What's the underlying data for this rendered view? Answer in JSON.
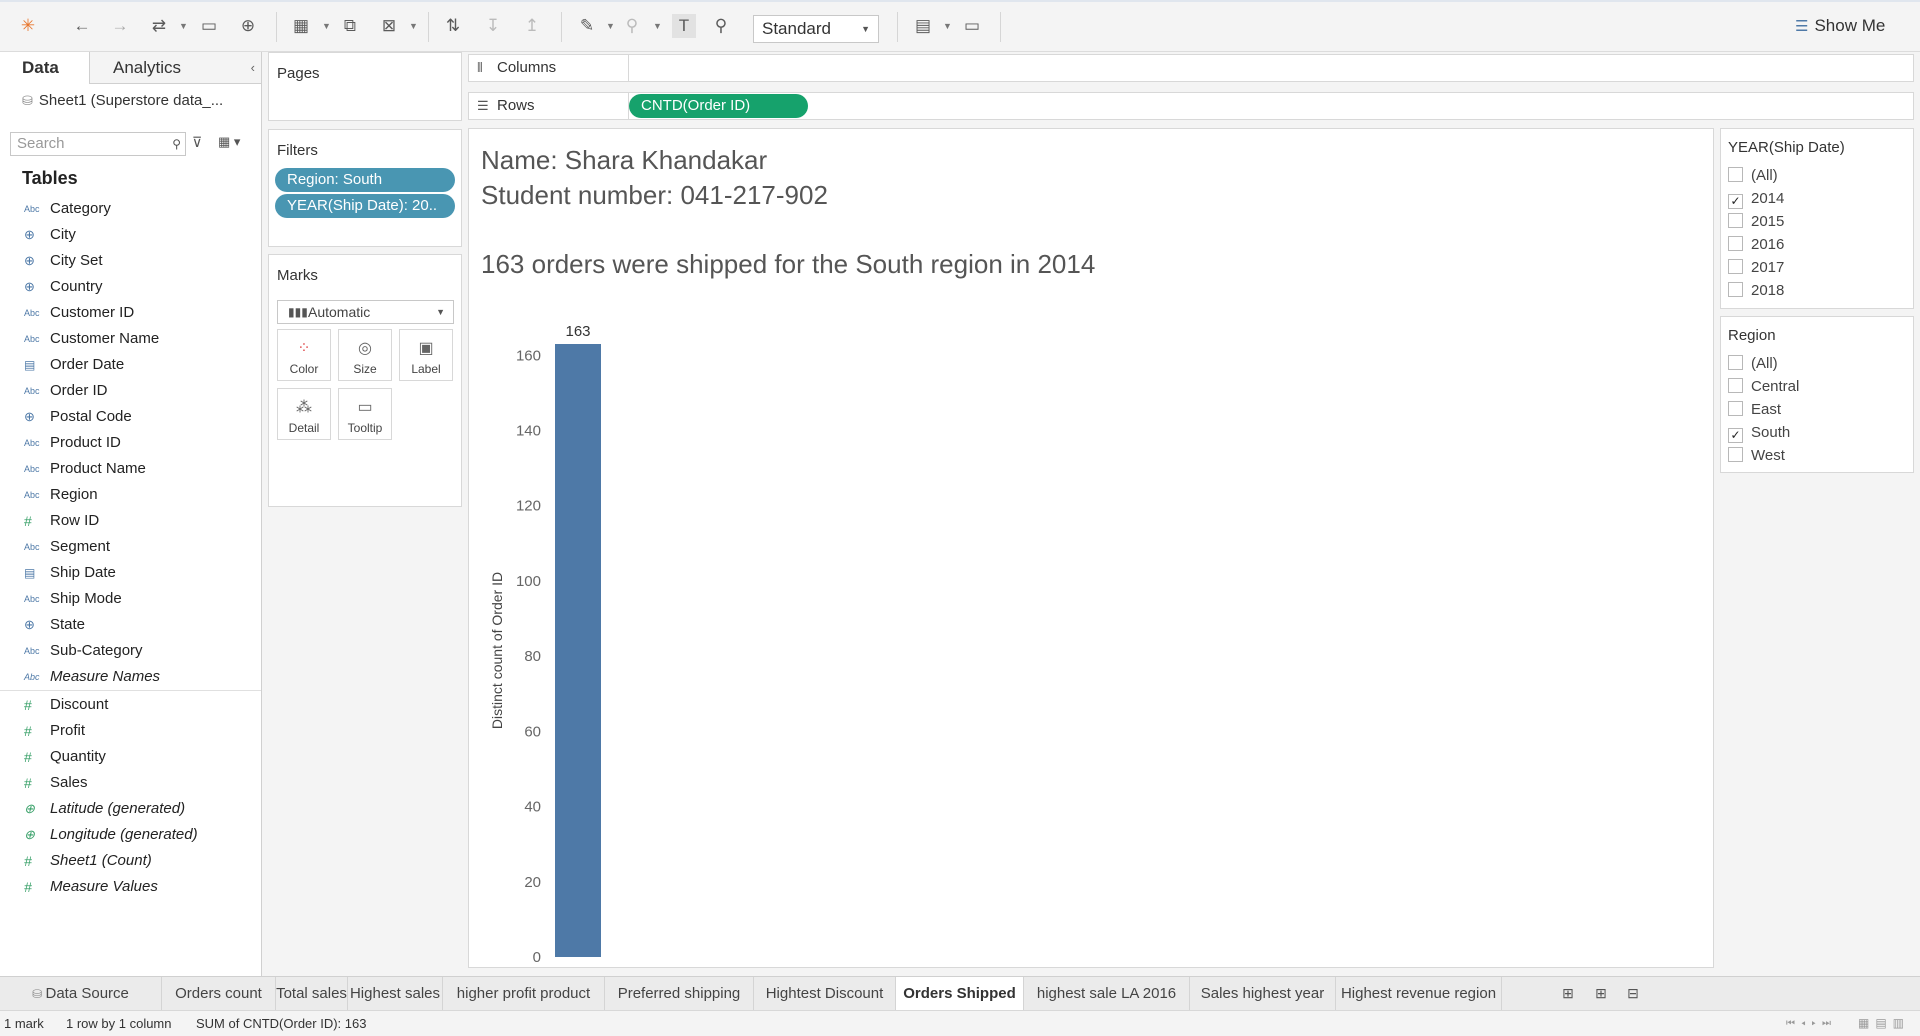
{
  "toolbar": {
    "view_mode": "Standard",
    "show_me": "Show Me"
  },
  "datapane": {
    "tab_data": "Data",
    "tab_analytics": "Analytics",
    "source": "Sheet1 (Superstore data_...",
    "search_placeholder": "Search",
    "tables_heading": "Tables",
    "dimensions": [
      {
        "label": "Category",
        "type": "abc"
      },
      {
        "label": "City",
        "type": "globe"
      },
      {
        "label": "City Set",
        "type": "set"
      },
      {
        "label": "Country",
        "type": "globe"
      },
      {
        "label": "Customer ID",
        "type": "abc"
      },
      {
        "label": "Customer Name",
        "type": "abc"
      },
      {
        "label": "Order Date",
        "type": "date"
      },
      {
        "label": "Order ID",
        "type": "abc"
      },
      {
        "label": "Postal Code",
        "type": "globe"
      },
      {
        "label": "Product ID",
        "type": "abc"
      },
      {
        "label": "Product Name",
        "type": "abc"
      },
      {
        "label": "Region",
        "type": "abc"
      },
      {
        "label": "Row ID",
        "type": "hash"
      },
      {
        "label": "Segment",
        "type": "abc"
      },
      {
        "label": "Ship Date",
        "type": "date"
      },
      {
        "label": "Ship Mode",
        "type": "abc"
      },
      {
        "label": "State",
        "type": "globe"
      },
      {
        "label": "Sub-Category",
        "type": "abc"
      },
      {
        "label": "Measure Names",
        "type": "abc",
        "italic": true
      }
    ],
    "measures": [
      {
        "label": "Discount",
        "type": "hash"
      },
      {
        "label": "Profit",
        "type": "hash"
      },
      {
        "label": "Quantity",
        "type": "hash"
      },
      {
        "label": "Sales",
        "type": "hash"
      },
      {
        "label": "Latitude (generated)",
        "type": "globe",
        "italic": true
      },
      {
        "label": "Longitude (generated)",
        "type": "globe",
        "italic": true
      },
      {
        "label": "Sheet1 (Count)",
        "type": "hash",
        "italic": true
      },
      {
        "label": "Measure Values",
        "type": "hash",
        "italic": true
      }
    ]
  },
  "pages": {
    "title": "Pages"
  },
  "filters": {
    "title": "Filters",
    "pills": [
      "Region: South",
      "YEAR(Ship Date): 20.."
    ]
  },
  "marks": {
    "title": "Marks",
    "type": "Automatic",
    "buttons": [
      "Color",
      "Size",
      "Label",
      "Detail",
      "Tooltip"
    ]
  },
  "columns_shelf": {
    "label": "Columns"
  },
  "rows_shelf": {
    "label": "Rows",
    "pill": "CNTD(Order ID)"
  },
  "viz": {
    "line1": "Name: Shara Khandakar",
    "line2": "Student number: 041-217-902",
    "line3": "163 orders were shipped for the South region in 2014"
  },
  "chart_data": {
    "type": "bar",
    "categories": [
      ""
    ],
    "values": [
      163
    ],
    "data_labels": [
      "163"
    ],
    "ylabel": "Distinct count of Order ID",
    "ylim": [
      0,
      163
    ],
    "yticks": [
      0,
      20,
      40,
      60,
      80,
      100,
      120,
      140,
      160
    ],
    "bar_color": "#4e79a7",
    "grid": false
  },
  "year_filter": {
    "title": "YEAR(Ship Date)",
    "options": [
      {
        "label": "(All)",
        "checked": false
      },
      {
        "label": "2014",
        "checked": true
      },
      {
        "label": "2015",
        "checked": false
      },
      {
        "label": "2016",
        "checked": false
      },
      {
        "label": "2017",
        "checked": false
      },
      {
        "label": "2018",
        "checked": false
      }
    ]
  },
  "region_filter": {
    "title": "Region",
    "options": [
      {
        "label": "(All)",
        "checked": false
      },
      {
        "label": "Central",
        "checked": false
      },
      {
        "label": "East",
        "checked": false
      },
      {
        "label": "South",
        "checked": true
      },
      {
        "label": "West",
        "checked": false
      }
    ]
  },
  "sheet_tabs": {
    "data_source": "Data Source",
    "tabs": [
      "Orders count",
      "Total sales",
      "Highest sales",
      "higher profit product",
      "Preferred shipping",
      "Hightest Discount",
      "Orders Shipped",
      "highest sale LA 2016",
      "Sales highest year",
      "Highest revenue region"
    ],
    "active": "Orders Shipped"
  },
  "status": {
    "marks": "1 mark",
    "dims": "1 row by 1 column",
    "sum": "SUM of CNTD(Order ID): 163"
  },
  "colors": {
    "dimension_pill": "#4996b2",
    "measure_pill": "#16a26c",
    "bar": "#4e79a7"
  }
}
